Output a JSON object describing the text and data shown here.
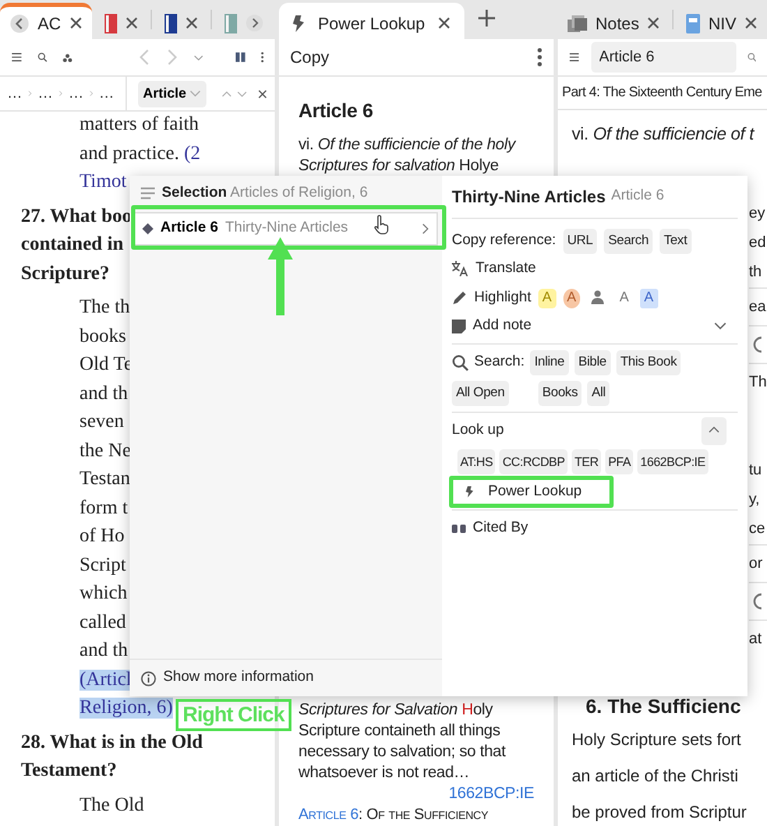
{
  "left_pane": {
    "focused": true,
    "tabs": [
      {
        "kind": "text",
        "label": "AC",
        "selected": true
      },
      {
        "kind": "cover",
        "color": "#d63a40",
        "selected": false
      },
      {
        "kind": "cover",
        "color": "#1e3c92",
        "selected": false
      },
      {
        "kind": "cover",
        "color": "#7fa9a5",
        "selected": false
      }
    ],
    "history": [
      {
        "kind": "back",
        "disabled": true
      },
      {
        "kind": "forward",
        "disabled": true
      }
    ],
    "breadcrumb": [
      "…",
      "…",
      "…",
      "…"
    ],
    "section_picker": "Article",
    "lines": [
      {
        "kind": "answer",
        "text": "matters of faith",
        "selected": false
      },
      {
        "kind": "answer",
        "text": "and practice. ",
        "link": "(2",
        "selected": false
      },
      {
        "kind": "answer",
        "link": "Timot",
        "selected": false
      },
      {
        "kind": "question",
        "text": "27. What boo",
        "selected": false
      },
      {
        "kind": "question",
        "text": "contained in",
        "selected": false
      },
      {
        "kind": "question",
        "text": "Scripture?",
        "selected": false
      },
      {
        "kind": "answer",
        "text": "The th",
        "selected": false
      },
      {
        "kind": "answer",
        "text": "books",
        "selected": false
      },
      {
        "kind": "answer",
        "text": "Old Te",
        "selected": false
      },
      {
        "kind": "answer",
        "text": "and th",
        "selected": false
      },
      {
        "kind": "answer",
        "text": "seven",
        "selected": false
      },
      {
        "kind": "answer",
        "text": "the Ne",
        "selected": false
      },
      {
        "kind": "answer",
        "text": "Testan",
        "selected": false
      },
      {
        "kind": "answer",
        "text": "form t",
        "selected": false
      },
      {
        "kind": "answer",
        "text": "of Ho",
        "selected": false
      },
      {
        "kind": "answer",
        "text": "Script",
        "selected": false
      },
      {
        "kind": "answer",
        "text": "which",
        "selected": false
      },
      {
        "kind": "answer",
        "text": "called",
        "selected": false
      },
      {
        "kind": "answer",
        "text": "and th",
        "selected": false
      },
      {
        "kind": "answer",
        "link": "(Articl",
        "selected": true
      },
      {
        "kind": "answer",
        "link": "Religion, 6)",
        "selected": true
      },
      {
        "kind": "question",
        "text": "28. What is in the Old",
        "selected": false
      },
      {
        "kind": "question",
        "text": "Testament?",
        "selected": false
      },
      {
        "kind": "answer",
        "text": "The Old",
        "selected": false
      }
    ]
  },
  "middle_pane": {
    "tabs": [
      {
        "label": "Power Lookup",
        "selected": true
      }
    ],
    "toolbar_label": "Copy",
    "heading": "Article 6",
    "intro_lines": [
      "vi. *Of the sufficiencie of the holy*",
      "*Scriptures for salvation* Holye"
    ],
    "result": {
      "first": {
        "lead": "*Scriptures for Salvation* ",
        "initial": "H",
        "rest": "oly"
      },
      "lines": [
        "Scripture containeth all things",
        "necessary to salvation; so that",
        "whatsoever is not read…"
      ],
      "source": "1662BCP:IE"
    },
    "next_title": {
      "link": "Article 6",
      "rest": ": Of the Sufficiency"
    }
  },
  "right_pane": {
    "tabs": [
      {
        "kind": "notes",
        "label": "Notes",
        "selected": false
      },
      {
        "kind": "book",
        "label": "NIV",
        "selected": false
      }
    ],
    "search": {
      "value": "Article 6"
    },
    "breadcrumb": "Part 4: The Sixteenth Century Eme",
    "first_line": "vi. *Of the sufficiencie of t*",
    "fragments": [
      {
        "kind": "text",
        "text": "ey"
      },
      {
        "kind": "text",
        "text": "ed"
      },
      {
        "kind": "text",
        "text": "th"
      },
      {
        "kind": "section",
        "text": "ea"
      },
      {
        "kind": "icon"
      },
      {
        "kind": "section",
        "text": "Th"
      },
      {
        "kind": "para",
        "text": "tu"
      },
      {
        "kind": "text",
        "text": "y,"
      },
      {
        "kind": "text",
        "text": "ce"
      },
      {
        "kind": "section",
        "text": "or"
      },
      {
        "kind": "icon"
      },
      {
        "kind": "section",
        "text": "at"
      }
    ],
    "heading": "6. The Sufficienc",
    "lines": [
      "Holy Scripture sets fort",
      "an article of the Christi",
      "be proved from Scriptur"
    ]
  },
  "context_menu": {
    "selection": {
      "label": "Selection",
      "detail": "Articles of Religion, 6"
    },
    "items": [
      {
        "label": "Article 6",
        "detail": "Thirty-Nine Articles",
        "selected": true
      }
    ],
    "footer": "Show more information",
    "panel": {
      "title": "Thirty-Nine Articles",
      "subtitle": "Article 6",
      "copy_reference": {
        "label": "Copy reference:",
        "buttons": [
          "URL",
          "Search",
          "Text"
        ]
      },
      "translate": "Translate",
      "highlight": {
        "label": "Highlight",
        "styles": [
          {
            "kind": "marker",
            "label": "A"
          },
          {
            "kind": "circle",
            "label": "A"
          },
          {
            "kind": "user"
          },
          {
            "kind": "plain",
            "label": "A"
          },
          {
            "kind": "box",
            "label": "A"
          }
        ]
      },
      "add_note": {
        "label": "Add note",
        "expanded": false
      },
      "search": {
        "label": "Search:",
        "buttons": [
          "Inline",
          "Bible",
          "This Book",
          "All Open",
          "Books",
          "All"
        ]
      },
      "look_up": {
        "label": "Look up",
        "expanded": true,
        "buttons": [
          "AT:HS",
          "CC:RCDBP",
          "TER",
          "PFA",
          "1662BCP:IE"
        ],
        "power_lookup": "Power Lookup"
      },
      "cited_by": "Cited By"
    }
  },
  "annotation": {
    "label": "Right Click"
  }
}
